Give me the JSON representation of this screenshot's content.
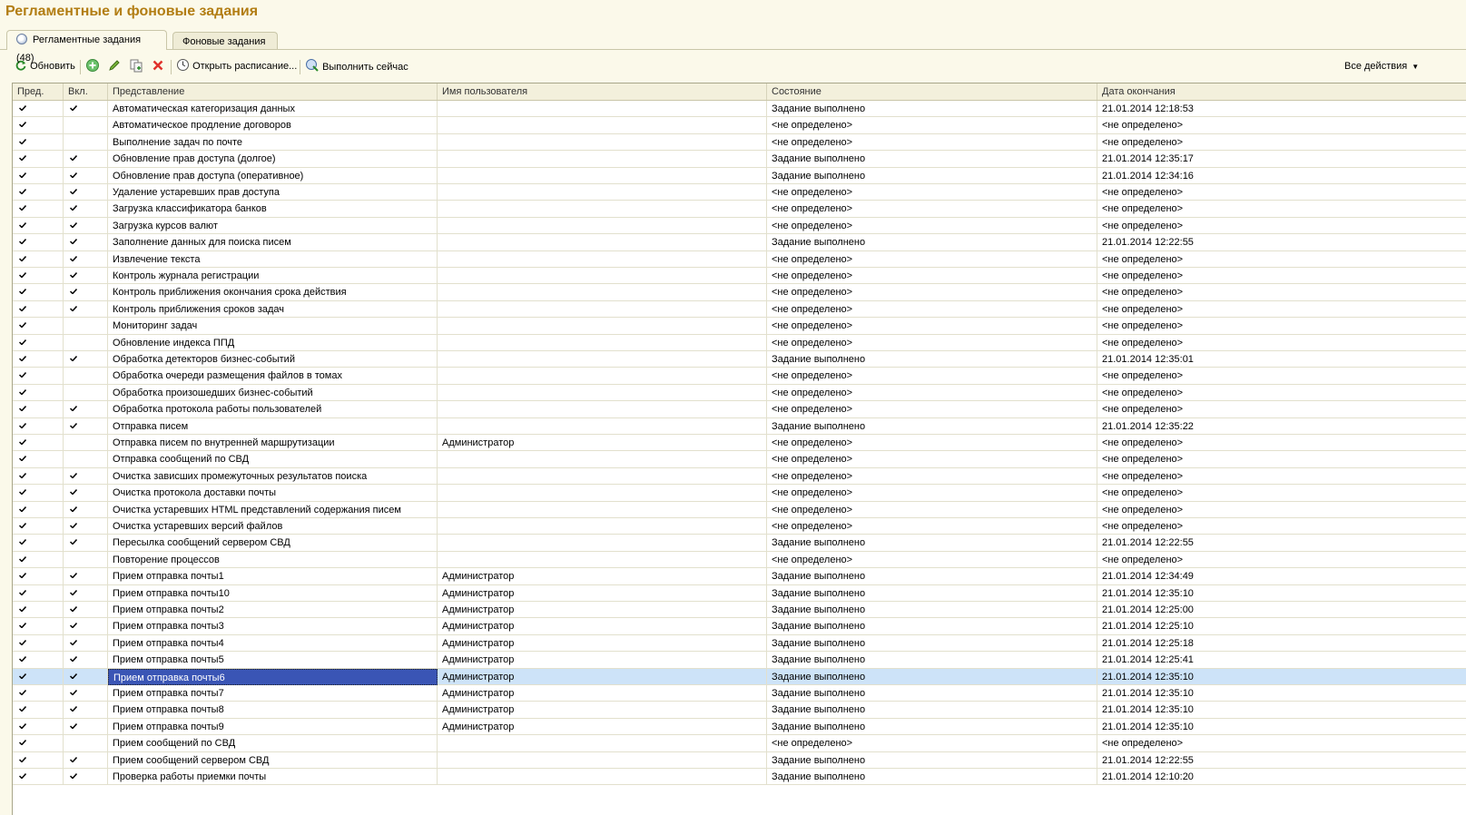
{
  "title": "Регламентные и фоновые задания",
  "tabs": [
    {
      "label": "Регламентные задания (48)",
      "active": true
    },
    {
      "label": "Фоновые задания",
      "active": false
    }
  ],
  "toolbar": {
    "refresh_label": "Обновить",
    "open_schedule_label": "Открыть расписание...",
    "run_now_label": "Выполнить сейчас",
    "all_actions_label": "Все действия"
  },
  "columns": [
    "Пред.",
    "Вкл.",
    "Представление",
    "Имя пользователя",
    "Состояние",
    "Дата окончания"
  ],
  "rows": [
    {
      "pred": true,
      "vkl": true,
      "name": "Автоматическая категоризация данных",
      "user": "",
      "state": "Задание выполнено",
      "end": "21.01.2014 12:18:53"
    },
    {
      "pred": true,
      "vkl": false,
      "name": "Автоматическое продление договоров",
      "user": "",
      "state": "<не определено>",
      "end": "<не определено>"
    },
    {
      "pred": true,
      "vkl": false,
      "name": "Выполнение задач по почте",
      "user": "",
      "state": "<не определено>",
      "end": "<не определено>"
    },
    {
      "pred": true,
      "vkl": true,
      "name": "Обновление прав доступа (долгое)",
      "user": "",
      "state": "Задание выполнено",
      "end": "21.01.2014 12:35:17"
    },
    {
      "pred": true,
      "vkl": true,
      "name": "Обновление прав доступа (оперативное)",
      "user": "",
      "state": "Задание выполнено",
      "end": "21.01.2014 12:34:16"
    },
    {
      "pred": true,
      "vkl": true,
      "name": "Удаление устаревших прав доступа",
      "user": "",
      "state": "<не определено>",
      "end": "<не определено>"
    },
    {
      "pred": true,
      "vkl": true,
      "name": "Загрузка классификатора банков",
      "user": "",
      "state": "<не определено>",
      "end": "<не определено>"
    },
    {
      "pred": true,
      "vkl": true,
      "name": "Загрузка курсов валют",
      "user": "",
      "state": "<не определено>",
      "end": "<не определено>"
    },
    {
      "pred": true,
      "vkl": true,
      "name": "Заполнение данных для поиска писем",
      "user": "",
      "state": "Задание выполнено",
      "end": "21.01.2014 12:22:55"
    },
    {
      "pred": true,
      "vkl": true,
      "name": "Извлечение текста",
      "user": "",
      "state": "<не определено>",
      "end": "<не определено>"
    },
    {
      "pred": true,
      "vkl": true,
      "name": "Контроль журнала регистрации",
      "user": "",
      "state": "<не определено>",
      "end": "<не определено>"
    },
    {
      "pred": true,
      "vkl": true,
      "name": "Контроль приближения окончания срока действия",
      "user": "",
      "state": "<не определено>",
      "end": "<не определено>"
    },
    {
      "pred": true,
      "vkl": true,
      "name": "Контроль приближения сроков задач",
      "user": "",
      "state": "<не определено>",
      "end": "<не определено>"
    },
    {
      "pred": true,
      "vkl": false,
      "name": "Мониторинг задач",
      "user": "",
      "state": "<не определено>",
      "end": "<не определено>"
    },
    {
      "pred": true,
      "vkl": false,
      "name": "Обновление индекса ППД",
      "user": "",
      "state": "<не определено>",
      "end": "<не определено>"
    },
    {
      "pred": true,
      "vkl": true,
      "name": "Обработка детекторов бизнес-событий",
      "user": "",
      "state": "Задание выполнено",
      "end": "21.01.2014 12:35:01"
    },
    {
      "pred": true,
      "vkl": false,
      "name": "Обработка очереди размещения файлов в томах",
      "user": "",
      "state": "<не определено>",
      "end": "<не определено>"
    },
    {
      "pred": true,
      "vkl": false,
      "name": "Обработка произошедших бизнес-событий",
      "user": "",
      "state": "<не определено>",
      "end": "<не определено>"
    },
    {
      "pred": true,
      "vkl": true,
      "name": "Обработка протокола работы пользователей",
      "user": "",
      "state": "<не определено>",
      "end": "<не определено>"
    },
    {
      "pred": true,
      "vkl": true,
      "name": "Отправка писем",
      "user": "",
      "state": "Задание выполнено",
      "end": "21.01.2014 12:35:22"
    },
    {
      "pred": true,
      "vkl": false,
      "name": "Отправка писем по внутренней маршрутизации",
      "user": "Администратор",
      "state": "<не определено>",
      "end": "<не определено>"
    },
    {
      "pred": true,
      "vkl": false,
      "name": "Отправка сообщений по СВД",
      "user": "",
      "state": "<не определено>",
      "end": "<не определено>"
    },
    {
      "pred": true,
      "vkl": true,
      "name": "Очистка зависших промежуточных результатов поиска",
      "user": "",
      "state": "<не определено>",
      "end": "<не определено>"
    },
    {
      "pred": true,
      "vkl": true,
      "name": "Очистка протокола доставки почты",
      "user": "",
      "state": "<не определено>",
      "end": "<не определено>"
    },
    {
      "pred": true,
      "vkl": true,
      "name": "Очистка устаревших HTML представлений содержания писем",
      "user": "",
      "state": "<не определено>",
      "end": "<не определено>"
    },
    {
      "pred": true,
      "vkl": true,
      "name": "Очистка устаревших версий файлов",
      "user": "",
      "state": "<не определено>",
      "end": "<не определено>"
    },
    {
      "pred": true,
      "vkl": true,
      "name": "Пересылка сообщений сервером СВД",
      "user": "",
      "state": "Задание выполнено",
      "end": "21.01.2014 12:22:55"
    },
    {
      "pred": true,
      "vkl": false,
      "name": "Повторение процессов",
      "user": "",
      "state": "<не определено>",
      "end": "<не определено>"
    },
    {
      "pred": true,
      "vkl": true,
      "name": "Прием отправка почты1",
      "user": "Администратор",
      "state": "Задание выполнено",
      "end": "21.01.2014 12:34:49"
    },
    {
      "pred": true,
      "vkl": true,
      "name": "Прием отправка почты10",
      "user": "Администратор",
      "state": "Задание выполнено",
      "end": "21.01.2014 12:35:10"
    },
    {
      "pred": true,
      "vkl": true,
      "name": "Прием отправка почты2",
      "user": "Администратор",
      "state": "Задание выполнено",
      "end": "21.01.2014 12:25:00"
    },
    {
      "pred": true,
      "vkl": true,
      "name": "Прием отправка почты3",
      "user": "Администратор",
      "state": "Задание выполнено",
      "end": "21.01.2014 12:25:10"
    },
    {
      "pred": true,
      "vkl": true,
      "name": "Прием отправка почты4",
      "user": "Администратор",
      "state": "Задание выполнено",
      "end": "21.01.2014 12:25:18"
    },
    {
      "pred": true,
      "vkl": true,
      "name": "Прием отправка почты5",
      "user": "Администратор",
      "state": "Задание выполнено",
      "end": "21.01.2014 12:25:41"
    },
    {
      "pred": true,
      "vkl": true,
      "name": "Прием отправка почты6",
      "user": "Администратор",
      "state": "Задание выполнено",
      "end": "21.01.2014 12:35:10",
      "selected": true
    },
    {
      "pred": true,
      "vkl": true,
      "name": "Прием отправка почты7",
      "user": "Администратор",
      "state": "Задание выполнено",
      "end": "21.01.2014 12:35:10"
    },
    {
      "pred": true,
      "vkl": true,
      "name": "Прием отправка почты8",
      "user": "Администратор",
      "state": "Задание выполнено",
      "end": "21.01.2014 12:35:10"
    },
    {
      "pred": true,
      "vkl": true,
      "name": "Прием отправка почты9",
      "user": "Администратор",
      "state": "Задание выполнено",
      "end": "21.01.2014 12:35:10"
    },
    {
      "pred": true,
      "vkl": false,
      "name": "Прием сообщений по СВД",
      "user": "",
      "state": "<не определено>",
      "end": "<не определено>"
    },
    {
      "pred": true,
      "vkl": true,
      "name": "Прием сообщений сервером СВД",
      "user": "",
      "state": "Задание выполнено",
      "end": "21.01.2014 12:22:55"
    },
    {
      "pred": true,
      "vkl": true,
      "name": "Проверка работы приемки почты",
      "user": "",
      "state": "Задание выполнено",
      "end": "21.01.2014 12:10:20"
    }
  ]
}
